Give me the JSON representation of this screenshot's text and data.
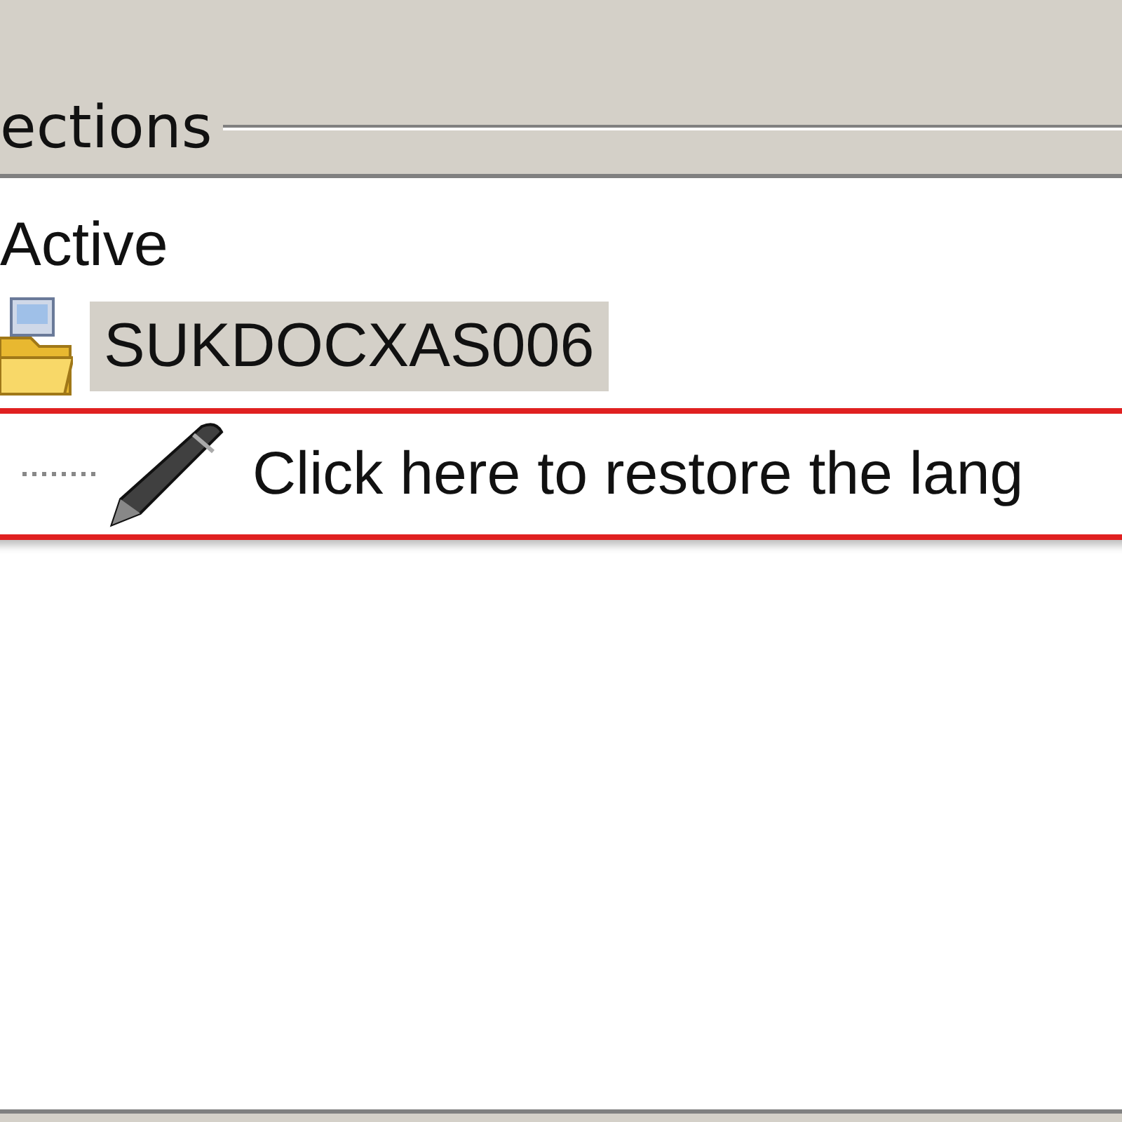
{
  "group": {
    "title": "ections"
  },
  "tree": [
    {
      "label": "Active",
      "children": [
        {
          "label": "SUKDOCXAS006",
          "kind": "server",
          "selected": true,
          "children": [
            {
              "label": "Click here to restore the lang",
              "kind": "action",
              "selected": false,
              "highlighted": true
            }
          ]
        }
      ]
    }
  ]
}
